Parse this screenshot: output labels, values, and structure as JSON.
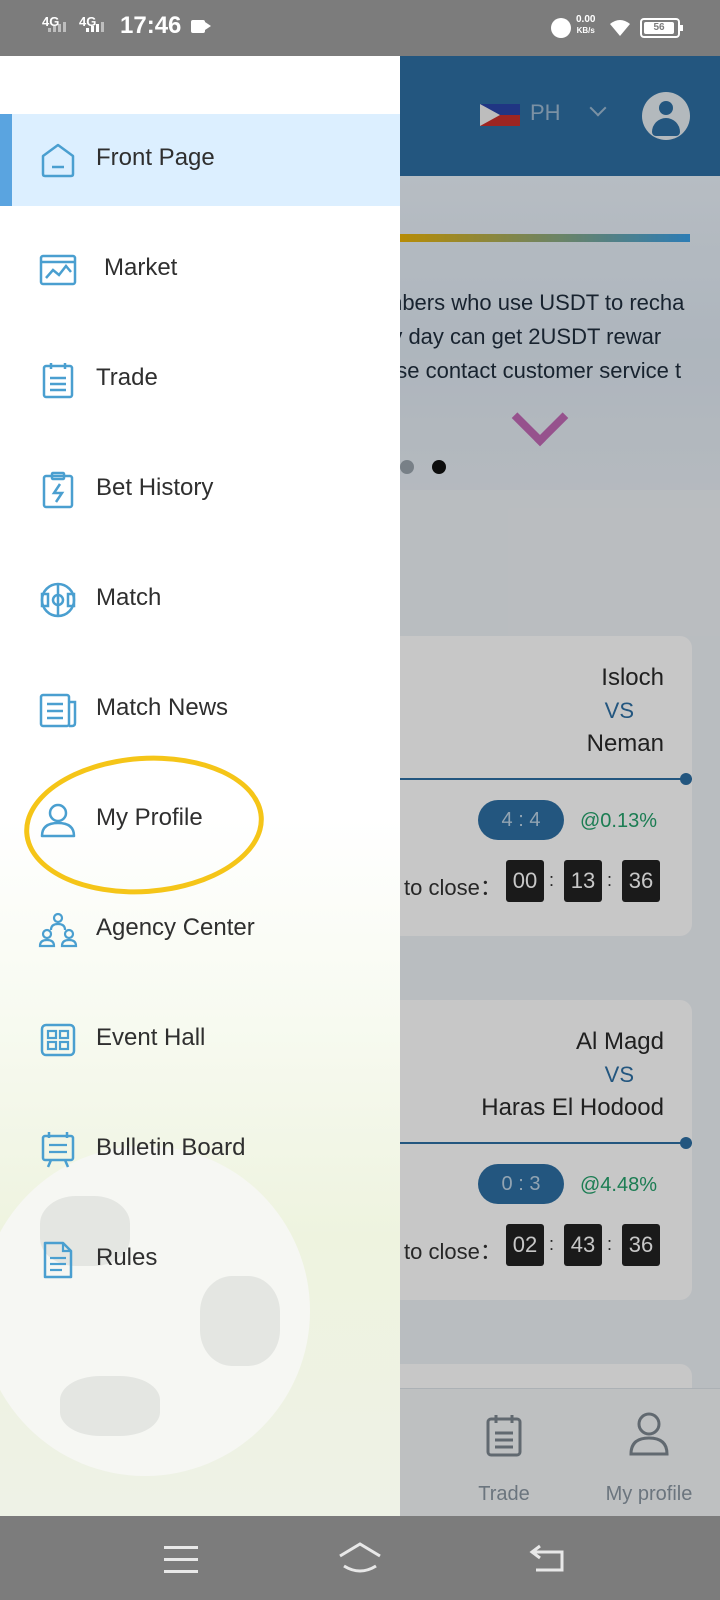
{
  "status_bar": {
    "net1": "4G",
    "net2": "4G",
    "time": "17:46",
    "speed_value": "0.00",
    "speed_unit": "KB/s",
    "battery": "56"
  },
  "header": {
    "language": "PH"
  },
  "banner": {
    "lines": [
      "mbers who use USDT to recha",
      "ry day can get   2USDT   rewar",
      "ase contact customer service t"
    ]
  },
  "matches": [
    {
      "home": "Isloch",
      "vs": "VS",
      "away": "Neman",
      "score": "4 : 4",
      "odds": "@0.13%",
      "close_label": "to close：",
      "time": [
        "00",
        "13",
        "36"
      ]
    },
    {
      "home": "Al Magd",
      "vs": "VS",
      "away": "Haras El Hodood",
      "score": "0 : 3",
      "odds": "@4.48%",
      "close_label": "to close：",
      "time": [
        "02",
        "43",
        "36"
      ]
    }
  ],
  "bottom_nav": {
    "trade": "Trade",
    "my_profile": "My profile"
  },
  "drawer": {
    "items": [
      {
        "label": "Front Page",
        "icon": "home-icon",
        "active": true
      },
      {
        "label": "Market",
        "icon": "market-chart-icon",
        "active": false
      },
      {
        "label": "Trade",
        "icon": "trade-clipboard-icon",
        "active": false
      },
      {
        "label": "Bet History",
        "icon": "bet-history-icon",
        "active": false
      },
      {
        "label": "Match",
        "icon": "soccer-field-icon",
        "active": false
      },
      {
        "label": "Match News",
        "icon": "news-icon",
        "active": false
      },
      {
        "label": "My Profile",
        "icon": "user-icon",
        "active": false,
        "circled": true
      },
      {
        "label": "Agency Center",
        "icon": "team-icon",
        "active": false
      },
      {
        "label": "Event Hall",
        "icon": "grid-icon",
        "active": false
      },
      {
        "label": "Bulletin Board",
        "icon": "bulletin-icon",
        "active": false
      },
      {
        "label": "Rules",
        "icon": "document-icon",
        "active": false
      }
    ]
  },
  "colors": {
    "primary": "#2d6fa3",
    "active_bg": "#dcefff",
    "active_bar": "#5aa4e0",
    "icon": "#4a9fd0",
    "highlight": "#f5c518",
    "odds_green": "#24a06b"
  }
}
